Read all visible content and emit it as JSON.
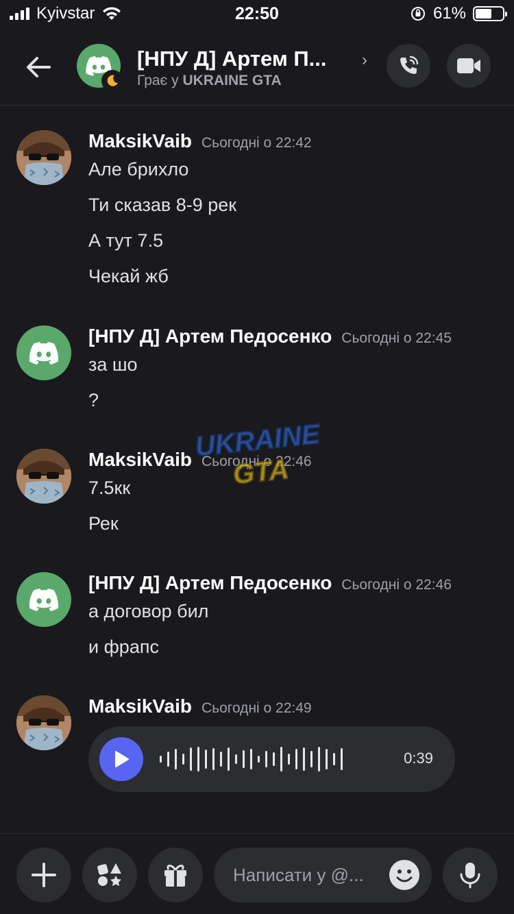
{
  "status_bar": {
    "carrier": "Kyivstar",
    "time": "22:50",
    "battery": "61%",
    "battery_level": 0.61
  },
  "header": {
    "title": "[НПУ Д] Артем П...",
    "status_prefix": "Грає у",
    "status_game": "UKRAINE GTA",
    "icons": [
      "back-arrow-icon",
      "discord-logo-icon",
      "moon-icon",
      "chevron-right-icon",
      "phone-call-icon",
      "video-camera-icon"
    ]
  },
  "messages": [
    {
      "author": "MaksikVaib",
      "time": "Сьогодні о 22:42",
      "lines": [
        "Але брихло",
        "Ти сказав 8-9 рек",
        "А тут 7.5",
        "Чекай жб"
      ]
    },
    {
      "author": "[НПУ Д] Артем Педосенко",
      "time": "Сьогодні о 22:45",
      "lines": [
        "за шо",
        "?"
      ]
    },
    {
      "author": "MaksikVaib",
      "time": "Сьогодні о 22:46",
      "lines": [
        "7.5кк",
        "Рек"
      ]
    },
    {
      "author": "[НПУ Д] Артем Педосенко",
      "time": "Сьогодні о 22:46",
      "lines": [
        "а договор бил",
        "и фрапс"
      ]
    },
    {
      "author": "MaksikVaib",
      "time": "Сьогодні о 22:49",
      "voice_duration": "0:39"
    }
  ],
  "watermark": {
    "line1": "UKRAINE",
    "line2": "GTA"
  },
  "composer": {
    "placeholder": "Написати у @...",
    "icons": [
      "plus-icon",
      "apps-icon",
      "gift-icon",
      "emoji-icon",
      "microphone-icon"
    ]
  },
  "colors": {
    "background": "#1a1a1e",
    "surface": "#2b2d31",
    "discord_green": "#5aa86b",
    "blurple": "#5865f2"
  }
}
